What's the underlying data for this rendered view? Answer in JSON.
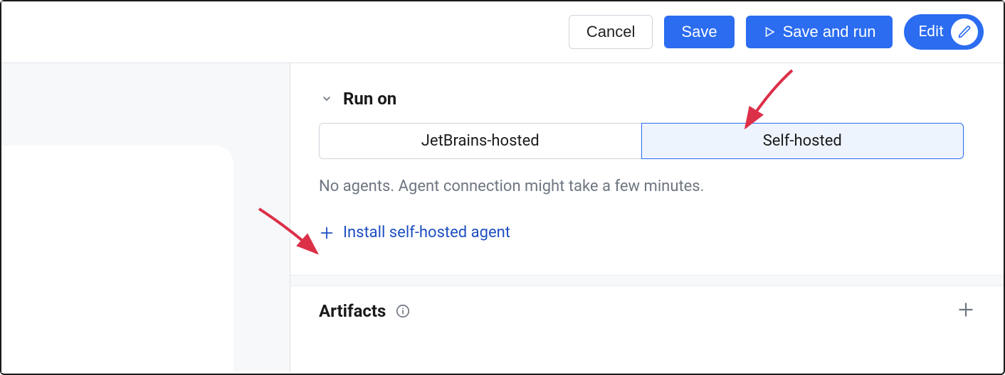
{
  "toolbar": {
    "cancel": "Cancel",
    "save": "Save",
    "saveRun": "Save and run",
    "edit": "Edit"
  },
  "runOn": {
    "title": "Run on",
    "options": {
      "jetbrains": "JetBrains-hosted",
      "self": "Self-hosted"
    },
    "status": "No agents. Agent connection might take a few minutes.",
    "installLink": "Install self-hosted agent"
  },
  "artifacts": {
    "title": "Artifacts"
  }
}
